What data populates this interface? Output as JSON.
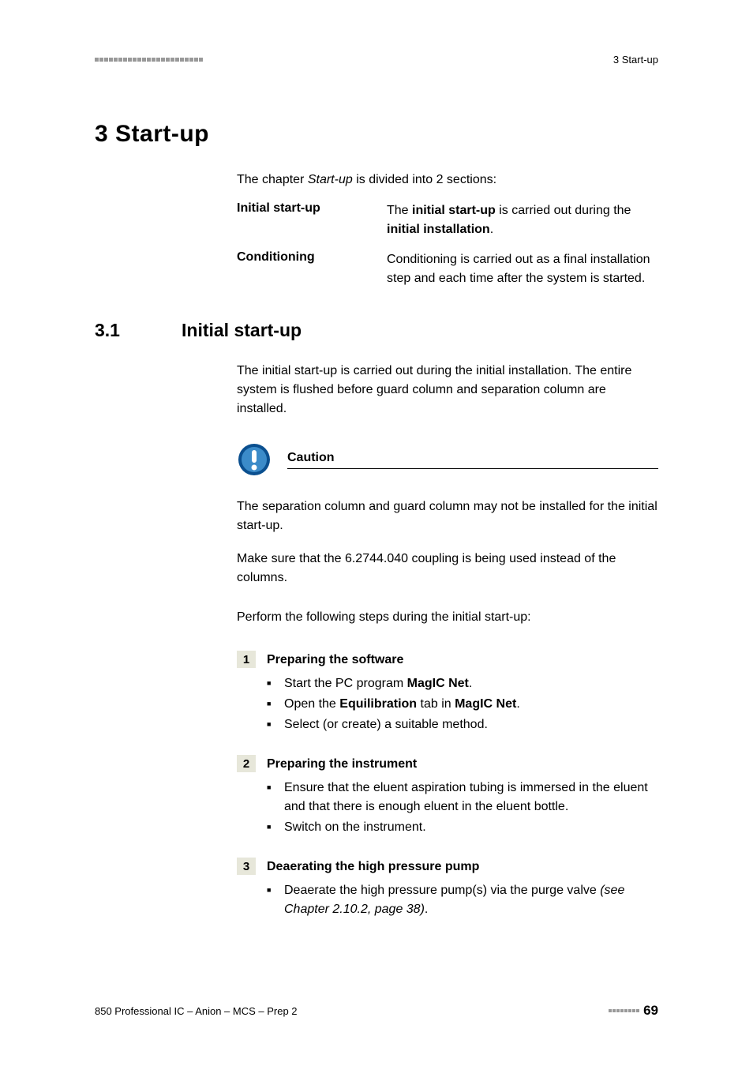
{
  "header": {
    "right": "3 Start-up"
  },
  "chapter": {
    "title": "3   Start-up"
  },
  "intro": "The chapter Start-up is divided into 2 sections:",
  "defs": {
    "row1": {
      "term": "Initial start-up",
      "desc_prefix": "The ",
      "desc_bold1": "initial start-up",
      "desc_mid": " is carried out during the ",
      "desc_bold2": "initial installation",
      "desc_suffix": "."
    },
    "row2": {
      "term": "Conditioning",
      "desc": "Conditioning is carried out as a final installation step and each time after the system is started."
    }
  },
  "section": {
    "num": "3.1",
    "title": "Initial start-up"
  },
  "section_body": "The initial start-up is carried out during the initial installation. The entire system is flushed before guard column and separation column are installed.",
  "caution": {
    "label": "Caution",
    "p1": "The separation column and guard column may not be installed for the initial start-up.",
    "p2": "Make sure that the 6.2744.040 coupling is being used instead of the columns."
  },
  "perform_text": "Perform the following steps during the initial start-up:",
  "steps": {
    "s1": {
      "num": "1",
      "title": "Preparing the software",
      "b1_pre": "Start the PC program ",
      "b1_bold": "MagIC Net",
      "b1_post": ".",
      "b2_pre": "Open the ",
      "b2_bold1": "Equilibration",
      "b2_mid": " tab in ",
      "b2_bold2": "MagIC Net",
      "b2_post": ".",
      "b3": "Select (or create) a suitable method."
    },
    "s2": {
      "num": "2",
      "title": "Preparing the instrument",
      "b1": "Ensure that the eluent aspiration tubing is immersed in the eluent and that there is enough eluent in the eluent bottle.",
      "b2": "Switch on the instrument."
    },
    "s3": {
      "num": "3",
      "title": "Deaerating the high pressure pump",
      "b1_pre": "Deaerate the high pressure pump(s) via the purge valve ",
      "b1_italic": "(see Chapter 2.10.2, page 38)",
      "b1_post": "."
    }
  },
  "footer": {
    "left": "850 Professional IC – Anion – MCS – Prep 2",
    "page": "69"
  }
}
